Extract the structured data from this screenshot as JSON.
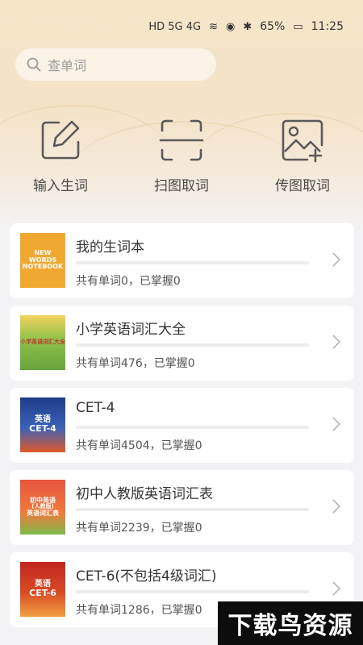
{
  "status_bar": {
    "network": "HD 5G 4G",
    "battery": "65%",
    "time": "11:25"
  },
  "search": {
    "placeholder": "查单词",
    "icon": "search-icon"
  },
  "actions": [
    {
      "label": "输入生词",
      "icon": "edit-icon"
    },
    {
      "label": "扫图取词",
      "icon": "scan-icon"
    },
    {
      "label": "传图取词",
      "icon": "image-upload-icon"
    }
  ],
  "wordbooks": [
    {
      "title": "我的生词本",
      "stats": "共有单词0，已掌握0",
      "progress": 0,
      "cover": {
        "lines": [
          "NEW WORDS",
          "NOTEBOOK"
        ],
        "bg": "#f0a830",
        "fg": "#ffffff"
      }
    },
    {
      "title": "小学英语词汇大全",
      "stats": "共有单词476，已掌握0",
      "progress": 0,
      "cover": {
        "lines": [
          "小学英语词汇大全"
        ],
        "bg": "#8cc24a",
        "fg": "#ffffff"
      }
    },
    {
      "title": "CET-4",
      "stats": "共有单词4504，已掌握0",
      "progress": 0,
      "cover": {
        "lines": [
          "英语",
          "CET-4"
        ],
        "bg": "#1f3c8a",
        "fg": "#ffffff"
      }
    },
    {
      "title": "初中人教版英语词汇表",
      "stats": "共有单词2239，已掌握0",
      "progress": 0,
      "cover": {
        "lines": [
          "初中英语",
          "(人教版)",
          "英语词汇表"
        ],
        "bg": "#e8553e",
        "fg": "#ffffff"
      }
    },
    {
      "title": "CET-6(不包括4级词汇)",
      "stats": "共有单词1286，已掌握0",
      "progress": 0,
      "cover": {
        "lines": [
          "英语",
          "CET-6"
        ],
        "bg": "#c0261f",
        "fg": "#ffffff"
      }
    }
  ],
  "watermark": "下载鸟资源",
  "colors": {
    "accent": "#e9b35b",
    "hero": "#f3e2c6",
    "background": "#f3f3f5"
  }
}
